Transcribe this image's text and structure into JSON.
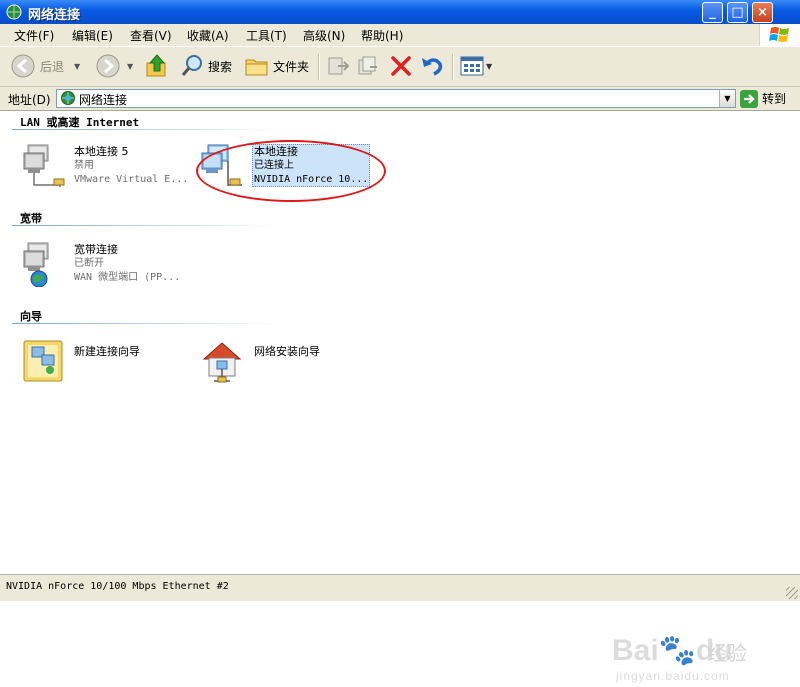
{
  "window": {
    "title": "网络连接",
    "min_label": "_",
    "max_label": "□",
    "close_label": "×"
  },
  "menu": [
    {
      "label": "文件(F)"
    },
    {
      "label": "编辑(E)"
    },
    {
      "label": "查看(V)"
    },
    {
      "label": "收藏(A)"
    },
    {
      "label": "工具(T)"
    },
    {
      "label": "高级(N)"
    },
    {
      "label": "帮助(H)"
    }
  ],
  "toolbar": {
    "back_label": "后退",
    "search_label": "搜索",
    "folders_label": "文件夹"
  },
  "address": {
    "label": "地址(D)",
    "value": "网络连接",
    "go_label": "转到"
  },
  "groups": {
    "lan": {
      "title": "LAN 或高速 Internet",
      "items": [
        {
          "name": "本地连接 5",
          "status": "禁用",
          "device": "VMware Virtual E..."
        },
        {
          "name": "本地连接",
          "status": "已连接上",
          "device": "NVIDIA nForce 10..."
        }
      ]
    },
    "broadband": {
      "title": "宽带",
      "items": [
        {
          "name": "宽带连接",
          "status": "已断开",
          "device": "WAN 微型端口 (PP..."
        }
      ]
    },
    "wizard": {
      "title": "向导",
      "items": [
        {
          "name": "新建连接向导"
        },
        {
          "name": "网络安装向导"
        }
      ]
    }
  },
  "status_bar": {
    "text": "NVIDIA nForce 10/100 Mbps Ethernet #2"
  },
  "watermark": {
    "brand": "Bai",
    "brand2": "du",
    "cn": "经验",
    "url": "jingyan.baidu.com"
  },
  "colors": {
    "titlebar": "#0a5ce4",
    "selection": "#cde3f8",
    "highlight_ellipse": "#e01818"
  }
}
